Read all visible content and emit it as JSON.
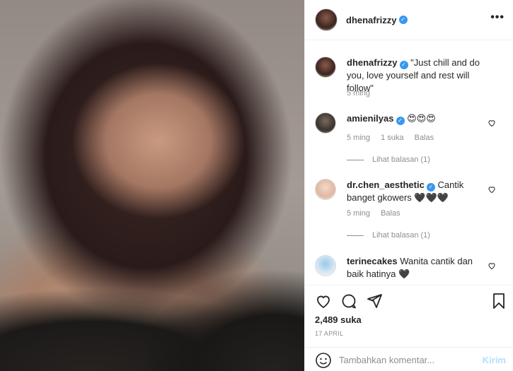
{
  "header": {
    "username": "dhenafrizzy",
    "more_label": "•••"
  },
  "caption": {
    "username": "dhenafrizzy",
    "text": "\"Just chill and do you, love yourself and rest will follow\"",
    "time": "5 ming"
  },
  "comments": [
    {
      "username": "amienilyas",
      "text": "😍😍😍",
      "time": "5 ming",
      "likes": "1 suka",
      "reply": "Balas",
      "view_replies": "Lihat balasan (1)"
    },
    {
      "username": "dr.chen_aesthetic",
      "text": "Cantik banget gkowers 🖤🖤🖤",
      "time": "5 ming",
      "reply": "Balas",
      "view_replies": "Lihat balasan (1)"
    },
    {
      "username": "terinecakes",
      "text": "Wanita cantik dan baik hatinya 🖤"
    }
  ],
  "likes": "2,489 suka",
  "date": "17 APRIL",
  "add_comment": {
    "placeholder": "Tambahkan komentar...",
    "post_label": "Kirim"
  },
  "colors": {
    "verified": "#3897f0",
    "muted": "#8e8e8e",
    "post_button": "#b2dffc"
  },
  "icons": [
    "heart-icon",
    "comment-icon",
    "share-icon",
    "bookmark-icon",
    "emoji-icon",
    "more-icon",
    "verified-icon"
  ]
}
